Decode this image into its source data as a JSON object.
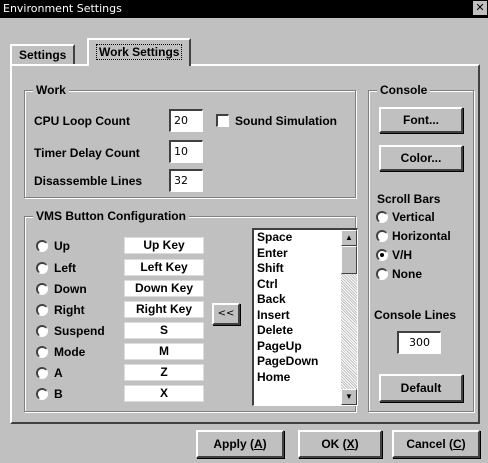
{
  "window": {
    "title": "Environment Settings",
    "close_glyph": "✕"
  },
  "tabs": [
    {
      "label": "Settings",
      "active": false
    },
    {
      "label": "Work Settings",
      "active": true
    }
  ],
  "work": {
    "legend": "Work",
    "cpu_loop_label": "CPU Loop Count",
    "cpu_loop_value": "20",
    "sound_label": "Sound Simulation",
    "sound_checked": false,
    "timer_label": "Timer Delay Count",
    "timer_value": "10",
    "disasm_label": "Disassemble Lines",
    "disasm_value": "32"
  },
  "vms": {
    "legend": "VMS Button Configuration",
    "buttons": [
      {
        "label": "Up",
        "key": "Up Key"
      },
      {
        "label": "Left",
        "key": "Left Key"
      },
      {
        "label": "Down",
        "key": "Down Key"
      },
      {
        "label": "Right",
        "key": "Right Key"
      },
      {
        "label": "Suspend",
        "key": "S"
      },
      {
        "label": "Mode",
        "key": "M"
      },
      {
        "label": "A",
        "key": "Z"
      },
      {
        "label": "B",
        "key": "X"
      }
    ],
    "assign_label": "<<",
    "key_list": [
      "Space",
      "Enter",
      "Shift",
      "Ctrl",
      "Back",
      "Insert",
      "Delete",
      "PageUp",
      "PageDown",
      "Home"
    ]
  },
  "console": {
    "legend": "Console",
    "font_button": "Font...",
    "color_button": "Color...",
    "scroll_bars_label": "Scroll Bars",
    "scroll_options": [
      {
        "label": "Vertical",
        "checked": false
      },
      {
        "label": "Horizontal",
        "checked": false
      },
      {
        "label": "V/H",
        "checked": true
      },
      {
        "label": "None",
        "checked": false
      }
    ],
    "console_lines_label": "Console Lines",
    "console_lines_value": "300",
    "default_button": "Default"
  },
  "footer": {
    "apply": {
      "text": "Apply (",
      "key": "A",
      "end": ")"
    },
    "ok": {
      "text": "OK (",
      "key": "X",
      "end": ")"
    },
    "cancel": {
      "text": "Cancel (",
      "key": "C",
      "end": ")"
    }
  }
}
